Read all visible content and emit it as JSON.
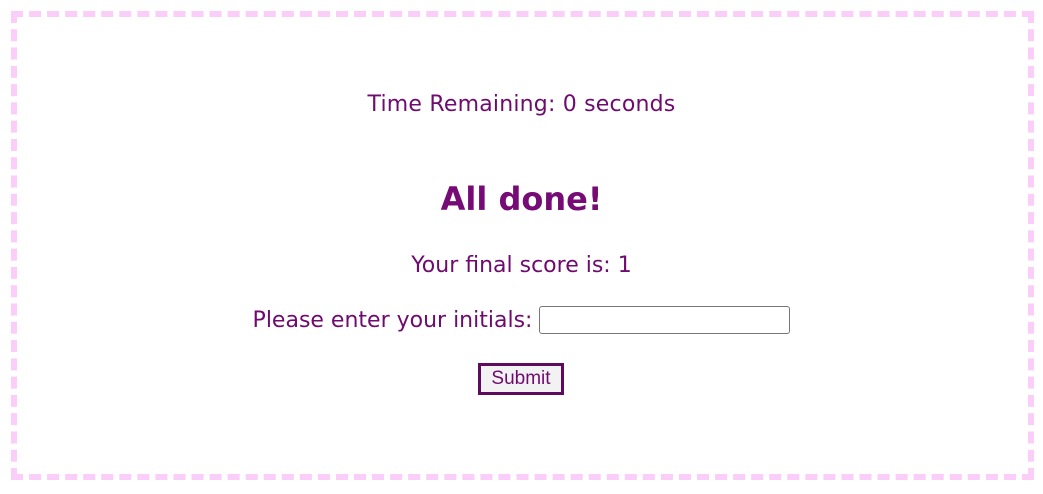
{
  "timer": {
    "text": "Time Remaining: 0 seconds"
  },
  "result": {
    "title": "All done!",
    "score_text": "Your final score is: 1"
  },
  "form": {
    "initials_label": "Please enter your initials:",
    "initials_value": "",
    "submit_label": "Submit"
  },
  "colors": {
    "text": "#6f0a6f",
    "border_dashes": "#fbcdf9",
    "button_border": "#5e0a5e"
  }
}
